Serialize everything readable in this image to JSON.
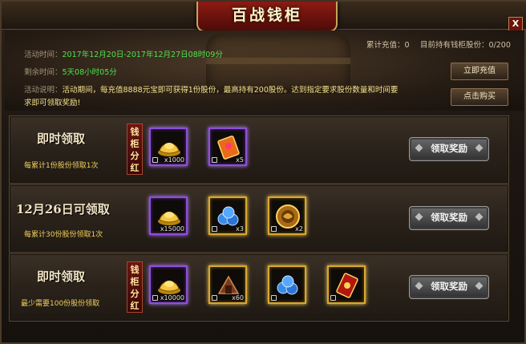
{
  "header": {
    "title": "百战钱柜",
    "close": "X",
    "activity_time_label": "活动时间：",
    "activity_time_value": "2017年12月20日-2017年12月27日08时09分",
    "remaining_label": "剩余时间：",
    "remaining_value": "5天08小时05分",
    "desc_label": "活动说明：",
    "desc_line1": "活动期间，每充值8888元宝即可获得1份股份，最高持有200股份。达到指定要求股份数量和时间要",
    "desc_line2": "求即可领取奖励!",
    "accum_label": "累计充值：",
    "accum_value": "0",
    "shares_label": "目前持有钱柜股份：",
    "shares_value": "0/200",
    "recharge_button": "立即充值",
    "buy_button": "点击购买"
  },
  "rows": [
    {
      "title": "即时领取",
      "subtitle": "每累计1份股份领取1次",
      "badge": "钱柜分红",
      "claim_label": "领取奖励",
      "items": [
        {
          "icon": "gold-ingot-icon",
          "count": "x1000",
          "rarity": "purple"
        },
        {
          "icon": "scroll-icon",
          "count": "x5",
          "rarity": "purple"
        }
      ]
    },
    {
      "title": "12月26日可领取",
      "subtitle": "每累计30份股份领取1次",
      "badge": "",
      "claim_label": "领取奖励",
      "items": [
        {
          "icon": "gold-ingot-icon",
          "count": "x15000",
          "rarity": "purple"
        },
        {
          "icon": "blue-orbs-icon",
          "count": "x3",
          "rarity": "gold"
        },
        {
          "icon": "dragon-medal-icon",
          "count": "x2",
          "rarity": "gold"
        }
      ]
    },
    {
      "title": "即时领取",
      "subtitle": "最少需要100份股份领取",
      "badge": "钱柜分红",
      "claim_label": "领取奖励",
      "items": [
        {
          "icon": "gold-ingot-icon",
          "count": "x10000",
          "rarity": "purple"
        },
        {
          "icon": "helmet-icon",
          "count": "x60",
          "rarity": "gold"
        },
        {
          "icon": "blue-orbs-icon",
          "count": "",
          "rarity": "gold"
        },
        {
          "icon": "red-card-icon",
          "count": "",
          "rarity": "gold"
        }
      ]
    }
  ]
}
